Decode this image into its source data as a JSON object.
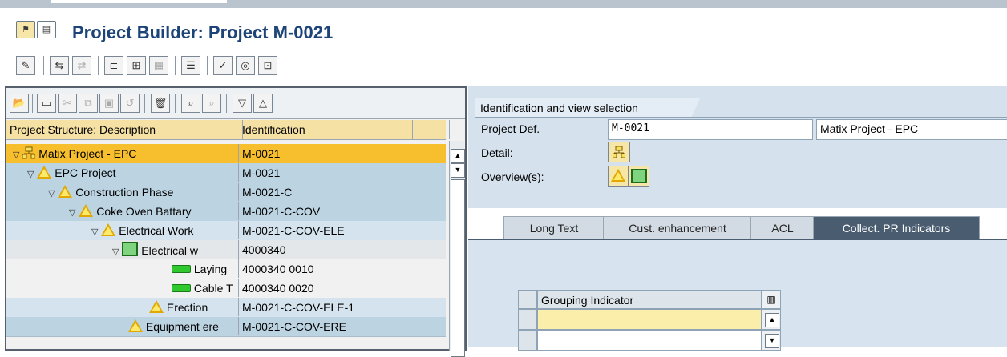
{
  "title": "Project Builder: Project M-0021",
  "icons": {
    "title_icons": [
      "project-builder-icon",
      "document-icon"
    ],
    "app_toolbar": [
      "edit-icon",
      "where-used-icon",
      "dependencies-icon",
      "hierarchy-icon",
      "structure-icon",
      "grid-icon",
      "planning-board-icon",
      "status-icon",
      "options-icon",
      "exit-icon"
    ]
  },
  "tree": {
    "columns": [
      "Project Structure: Description",
      "Identification"
    ],
    "rows": [
      {
        "desc": "Matix Project - EPC",
        "ident": "M-0021"
      },
      {
        "desc": "EPC Project",
        "ident": "M-0021"
      },
      {
        "desc": "Construction Phase",
        "ident": "M-0021-C"
      },
      {
        "desc": "Coke Oven Battary",
        "ident": "M-0021-C-COV"
      },
      {
        "desc": "Electrical Work",
        "ident": "M-0021-C-COV-ELE"
      },
      {
        "desc": "Electrical w",
        "ident": "4000340"
      },
      {
        "desc": "Laying",
        "ident": "4000340 0010"
      },
      {
        "desc": "Cable T",
        "ident": "4000340 0020"
      },
      {
        "desc": "Erection",
        "ident": "M-0021-C-COV-ELE-1"
      },
      {
        "desc": "Equipment ere",
        "ident": "M-0021-C-COV-ERE"
      }
    ]
  },
  "identification": {
    "tab_label": "Identification and view selection",
    "project_def_label": "Project Def.",
    "project_def_value": "M-0021",
    "project_desc_value": "Matix Project - EPC",
    "detail_label": "Detail:",
    "overview_label": "Overview(s):"
  },
  "tabs": [
    "Long Text",
    "Cust. enhancement",
    "ACL",
    "Collect. PR Indicators"
  ],
  "active_tab": "Collect. PR Indicators",
  "grouping": {
    "header": "Grouping Indicator"
  },
  "colors": {
    "title": "#1d4478",
    "selected_row": "#f7be2d",
    "tree_header": "#f6e1a4",
    "active_tab": "#4a5d70"
  }
}
